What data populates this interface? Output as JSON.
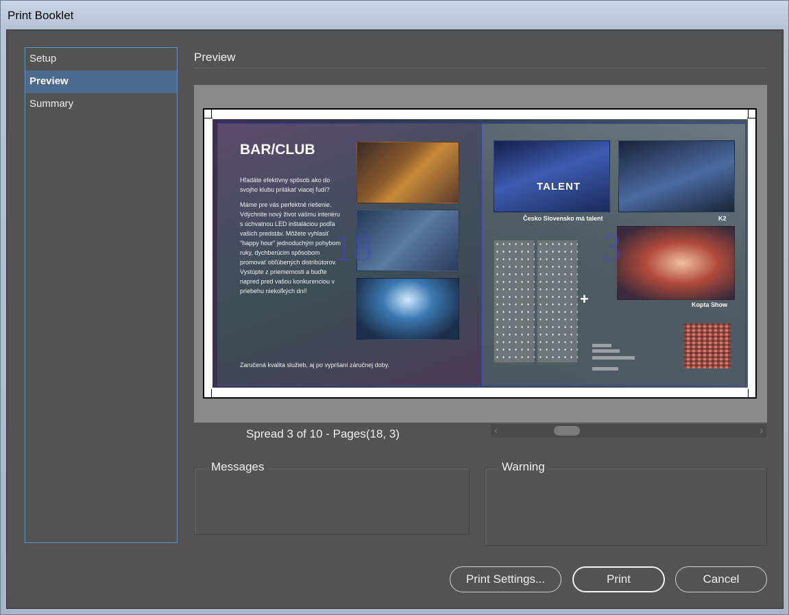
{
  "window": {
    "title": "Print Booklet"
  },
  "sidebar": {
    "items": [
      {
        "label": "Setup",
        "active": false
      },
      {
        "label": "Preview",
        "active": true
      },
      {
        "label": "Summary",
        "active": false
      }
    ]
  },
  "preview": {
    "section_title": "Preview",
    "spread_label": "Spread 3 of 10 - Pages(18, 3)",
    "left_page": {
      "page_number": "18",
      "heading": "BAR/CLUB",
      "paragraphs": [
        "Hľadáte efektívny spôsob ako do svojho klubu prilákať viacej ľudí?",
        "Máme pre vás perfektné riešenie. Vdýchnite nový život vášmu interiéru s úchvatnou LED inštaláciou podľa vašich predstáv. Môžete vyhlasiť \"happy hour\" jednoduchým pohybom ruky, dychberúcim spôsobom promovať obľúbených distribútorov. Vystúpte z priemernosti a buďte napred pred vašou konkurenciou v priebehu niekoľkých dní!"
      ],
      "footer": "Zaručená kvalita služieb, aj po vypršaní záručnej doby."
    },
    "right_page": {
      "page_number": "3",
      "captions": [
        "Česko Slovensko má talent",
        "K2",
        "Kopta Show"
      ],
      "logo_text": "TALENT"
    }
  },
  "messages": {
    "label": "Messages"
  },
  "warning": {
    "label": "Warning"
  },
  "buttons": {
    "print_settings": "Print Settings...",
    "print": "Print",
    "cancel": "Cancel"
  }
}
